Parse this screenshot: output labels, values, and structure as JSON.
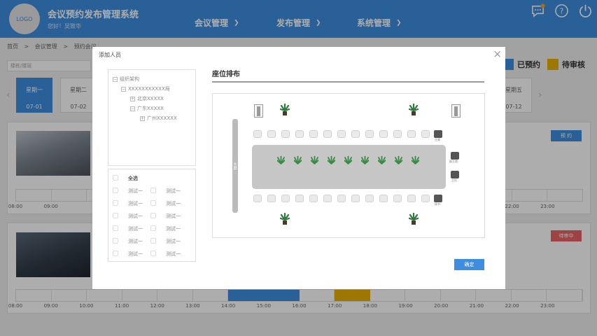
{
  "header": {
    "logo": "LOGO",
    "title": "会议预约发布管理系统",
    "greeting": "您好！吴致华",
    "nav": [
      {
        "label": "会议管理"
      },
      {
        "label": "发布管理"
      },
      {
        "label": "系统管理"
      }
    ],
    "notification_badge": "1"
  },
  "breadcrumb": [
    "首页",
    ">",
    "会议管理",
    ">",
    "预约会议"
  ],
  "search": {
    "placeholder": "楼栋/楼层"
  },
  "legend": [
    {
      "label": "已预约",
      "color": "#3d8ee0"
    },
    {
      "label": "待审核",
      "color": "#e8b000"
    }
  ],
  "days": [
    {
      "name": "星期一",
      "date": "07-01",
      "active": true
    },
    {
      "name": "星期二",
      "date": "07-02",
      "active": false
    },
    {
      "name": "星期五",
      "date": "07-12",
      "active": false
    }
  ],
  "rooms": [
    {
      "status_label": "预 约",
      "status_color": "#3d8ee0",
      "time_labels": [
        "08:00",
        "09:00",
        "22:00",
        "23:00"
      ]
    },
    {
      "status_label": "待审中",
      "status_color": "#e96464",
      "time_labels": [
        "08:00",
        "09:00",
        "10:00",
        "11:00",
        "12:00",
        "13:00",
        "14:00",
        "15:00",
        "16:00",
        "17:00",
        "18:00",
        "19:00",
        "20:00",
        "21:00",
        "22:00",
        "23:00"
      ]
    }
  ],
  "modal": {
    "title": "添加人员",
    "close_label": "×",
    "tree": {
      "root": "组织架构",
      "level1": "XXXXXXXXXXX局",
      "node_a": "北京XXXXX",
      "node_b": "广东XXXXX",
      "node_c": "广州XXXXXX"
    },
    "select_all": "全选",
    "people": [
      "测试一",
      "测试一",
      "测试一",
      "测试一",
      "测试一",
      "测试一",
      "测试一",
      "测试一",
      "测试一",
      "测试一",
      "测试一",
      "测试一"
    ],
    "seat_title": "座位排布",
    "screen_label": "大屏",
    "vip_labels": [
      "主席",
      "副主席",
      "主任",
      "秘书"
    ],
    "confirm_label": "确定"
  }
}
